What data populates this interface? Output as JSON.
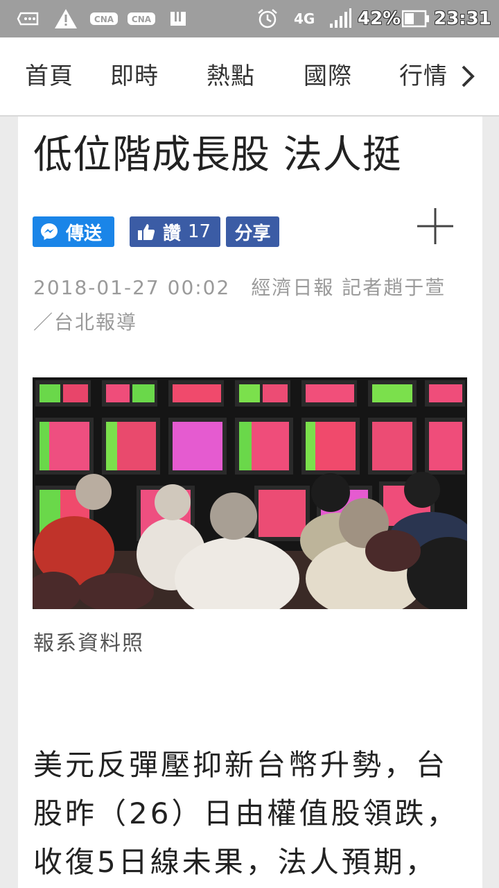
{
  "status_bar": {
    "network": "4G",
    "battery": "42%",
    "time": "23:31",
    "icons": [
      "sms-icon",
      "warning-icon",
      "cna-icon",
      "cna-icon",
      "bookmark-icon",
      "alarm-icon",
      "signal-icon",
      "battery-icon"
    ]
  },
  "nav": {
    "items": [
      "首頁",
      "即時",
      "熱點",
      "國際",
      "行情"
    ],
    "more_icon": "chevron-right-icon"
  },
  "article": {
    "title": "低位階成長股 法人挺",
    "actions": {
      "send_label": "傳送",
      "like_label": "讚",
      "like_count": "17",
      "share_label": "分享"
    },
    "meta": "2018-01-27 00:02　經濟日報 記者趙于萱／台北報導",
    "image_caption": "報系資料照",
    "body": "美元反彈壓抑新台幣升勢，台股昨（26）日由權值股領跌，收復5日線未果，法人預期，"
  },
  "colors": {
    "status_bar": "#9e9e9e",
    "send_button": "#1a85e8",
    "facebook_button": "#3b5ca5",
    "meta_text": "#9a9a9a"
  }
}
